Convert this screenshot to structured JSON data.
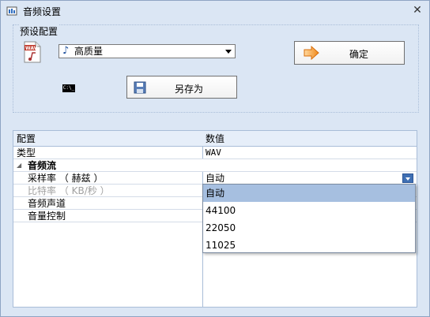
{
  "window": {
    "title": "音频设置",
    "close_glyph": "✕"
  },
  "preset": {
    "group_label": "预设配置",
    "selected_value": "高质量",
    "ok_label": "确定",
    "saveas_label": "另存为",
    "cmd_icon_text": "C:\\_"
  },
  "grid": {
    "headers": [
      "配置",
      "数值"
    ],
    "rows": [
      {
        "name": "类型",
        "value": "WAV"
      },
      {
        "name": "音频流",
        "value": ""
      },
      {
        "name": "采样率 （ 赫兹 ）",
        "value": "自动"
      },
      {
        "name": "比特率 （ KB/秒 ）",
        "value": ""
      },
      {
        "name": "音频声道",
        "value": ""
      },
      {
        "name": "音量控制",
        "value": ""
      }
    ]
  },
  "dropdown": {
    "options": [
      "自动",
      "44100",
      "22050",
      "11025"
    ],
    "selected_index": 0
  },
  "colors": {
    "background": "#dbe6f4",
    "selection": "#a6bfe0",
    "accent": "#3f6fb3"
  }
}
